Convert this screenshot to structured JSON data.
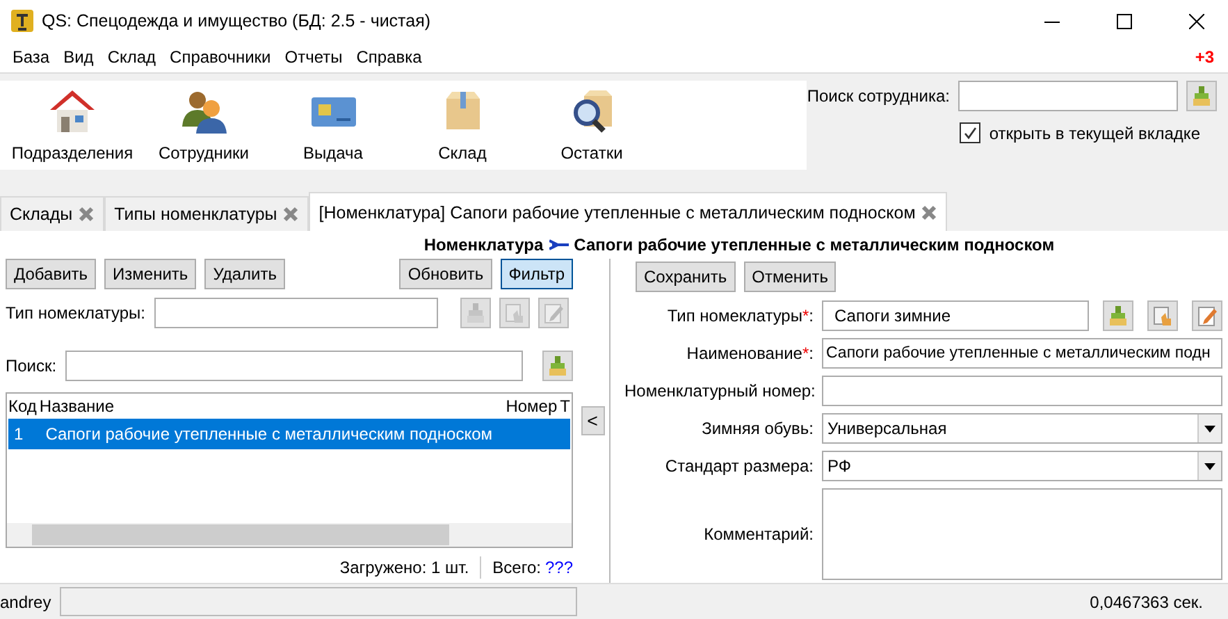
{
  "window": {
    "title": "QS: Спецодежда и имущество (БД: 2.5 - чистая)"
  },
  "menu": {
    "items": [
      "База",
      "Вид",
      "Склад",
      "Справочники",
      "Отчеты",
      "Справка"
    ],
    "badge": "+3"
  },
  "toolbar": {
    "buttons": [
      "Подразделения",
      "Сотрудники",
      "Выдача",
      "Склад",
      "Остатки"
    ]
  },
  "employee_search": {
    "label": "Поиск сотрудника:",
    "checkbox": {
      "label": "открыть в текущей вкладке",
      "checked": true
    }
  },
  "tabs": [
    {
      "label": "Склады",
      "selected": false
    },
    {
      "label": "Типы номенклатуры",
      "selected": false
    },
    {
      "label": "[Номенклатура] Сапоги рабочие утепленные с металлическим подноском",
      "selected": true
    }
  ],
  "breadcrumb": {
    "parent": "Номенклатура",
    "current": "Сапоги рабочие утепленные с металлическим подноском"
  },
  "list_panel": {
    "buttons": [
      {
        "label": "Добавить",
        "pressed": false
      },
      {
        "label": "Изменить",
        "pressed": false
      },
      {
        "label": "Удалить",
        "pressed": false
      },
      {
        "label": "Обновить",
        "pressed": false
      },
      {
        "label": "Фильтр",
        "pressed": true
      }
    ],
    "type_filter": {
      "label": "Тип номеклатуры:",
      "disabled": true
    },
    "search": {
      "label": "Поиск:"
    },
    "table": {
      "columns": [
        "Код",
        "Название",
        "Номер",
        "Т"
      ],
      "rows": [
        {
          "cells": [
            "1",
            "Сапоги рабочие утепленные с металлическим подноском"
          ],
          "selected": true
        }
      ]
    },
    "loaded": "Загружено: 1 шт.",
    "total_label": "Всего:",
    "total_link": "???"
  },
  "splitter": {
    "button": "<"
  },
  "form": {
    "buttons": [
      "Сохранить",
      "Отменить"
    ],
    "fields": [
      {
        "kind": "lookup",
        "label": "Тип номеклатуры*:",
        "required": true,
        "value": "Сапоги зимние",
        "disabled": false
      },
      {
        "kind": "text",
        "label": "Наименование*:",
        "required": true,
        "value": "Сапоги рабочие утепленные с металлическим подн"
      },
      {
        "kind": "text",
        "label": "Номенклатурный номер:"
      },
      {
        "kind": "combo",
        "label": "Зимняя обувь:",
        "value": "Универсальная"
      },
      {
        "kind": "combo",
        "label": "Стандарт размера:",
        "value": "РФ"
      },
      {
        "kind": "textarea",
        "label": "Комментарий:"
      }
    ]
  },
  "status_bar": {
    "user": "andrey",
    "time": "0,0467363 сек."
  }
}
